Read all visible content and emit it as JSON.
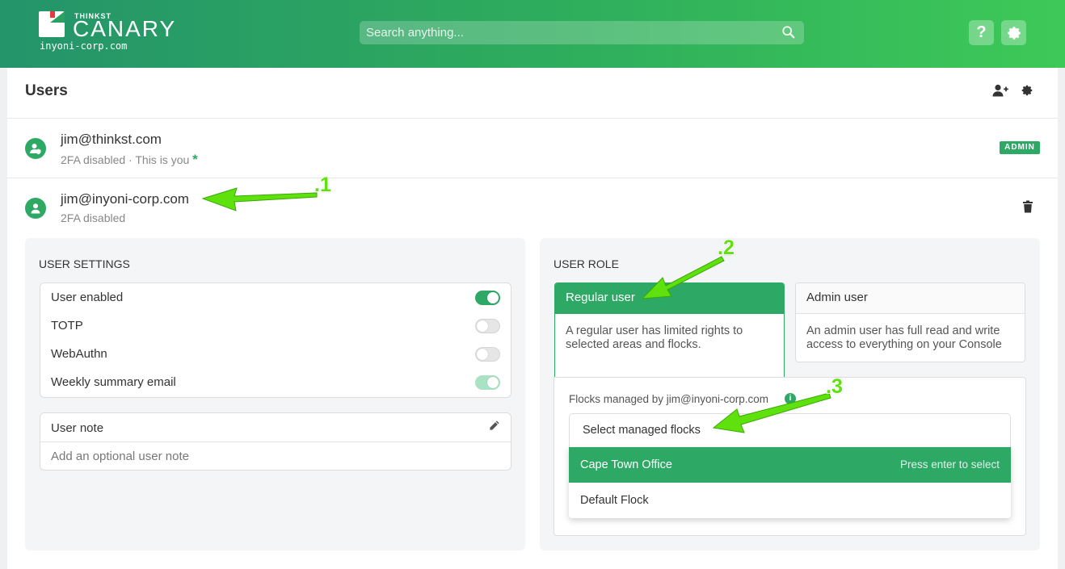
{
  "header": {
    "brand_small": "THINKST",
    "brand_name": "CANARY",
    "domain": "inyoni-corp.com",
    "search_placeholder": "Search anything...",
    "help_label": "?"
  },
  "colors": {
    "accent": "#2ea865",
    "header_gradient_start": "#24946a",
    "header_gradient_end": "#3dc958",
    "annotation": "#5fe10d"
  },
  "icons": [
    "search-icon",
    "help-icon",
    "gear-icon",
    "add-user-icon",
    "user-icon",
    "user-shield-icon",
    "trash-icon",
    "pencil-icon",
    "info-icon"
  ],
  "page": {
    "title": "Users"
  },
  "users": [
    {
      "email": "jim@thinkst.com",
      "status": "2FA disabled · This is you",
      "marker": "*",
      "badge": "ADMIN"
    },
    {
      "email": "jim@inyoni-corp.com",
      "status": "2FA disabled"
    }
  ],
  "user_settings": {
    "title": "USER SETTINGS",
    "toggles": [
      {
        "label": "User enabled",
        "state": "on"
      },
      {
        "label": "TOTP",
        "state": "off"
      },
      {
        "label": "WebAuthn",
        "state": "off"
      },
      {
        "label": "Weekly summary email",
        "state": "on"
      }
    ],
    "note_title": "User note",
    "note_placeholder": "Add an optional user note"
  },
  "user_role": {
    "title": "USER ROLE",
    "options": [
      {
        "label": "Regular user",
        "description": "A regular user has limited rights to selected areas and flocks.",
        "selected": true
      },
      {
        "label": "Admin user",
        "description": "An admin user has full read and write access to everything on your Console",
        "selected": false
      }
    ],
    "flocks_label": "Flocks managed by jim@inyoni-corp.com",
    "info_glyph": "i",
    "select_placeholder": "Select managed flocks",
    "flock_options": [
      {
        "label": "Cape Town Office",
        "hint": "Press enter to select",
        "highlighted": true
      },
      {
        "label": "Default Flock",
        "highlighted": false
      }
    ]
  },
  "annotations": [
    ".1",
    ".2",
    ".3"
  ]
}
